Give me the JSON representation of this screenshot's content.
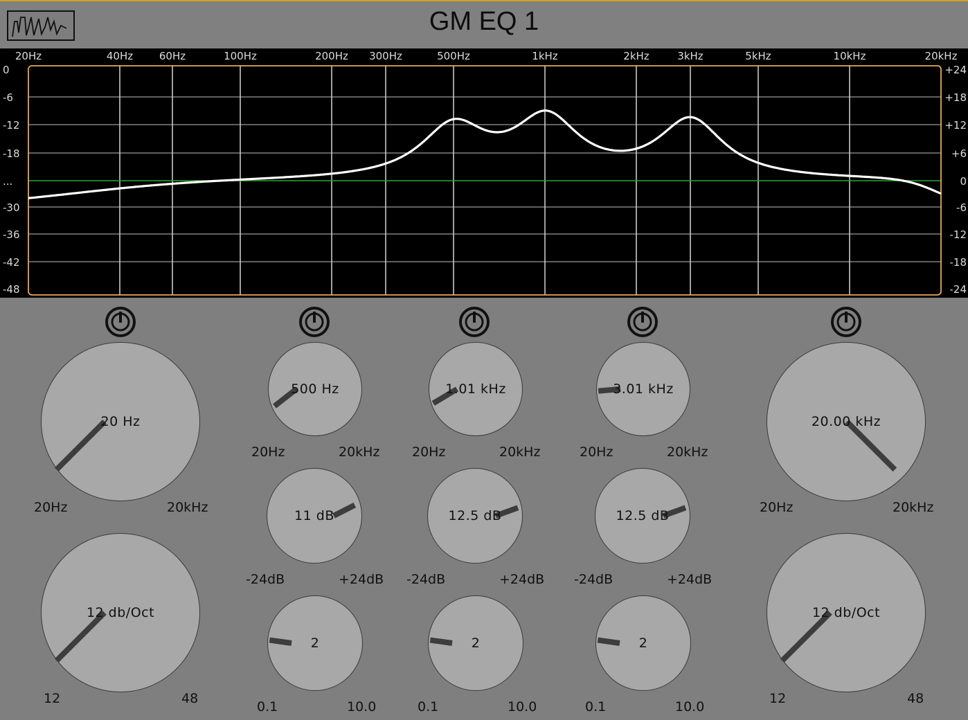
{
  "app": {
    "title": "GM EQ 1",
    "logo_icon": "waveform-logo-icon"
  },
  "graph": {
    "freq_labels": [
      "20Hz",
      "40Hz",
      "60Hz",
      "100Hz",
      "200Hz",
      "300Hz",
      "500Hz",
      "1kHz",
      "2kHz",
      "3kHz",
      "5kHz",
      "10kHz",
      "20kHz"
    ],
    "left_db_labels": [
      "0",
      "-6",
      "-12",
      "-18",
      "...",
      "-30",
      "-36",
      "-42",
      "-48"
    ],
    "right_db_labels": [
      "+24",
      "+18",
      "+12",
      "+6",
      "0",
      "-6",
      "-12",
      "-18",
      "-24"
    ],
    "colors": {
      "curve": "#ffffff",
      "zero_line": "#2fa52f",
      "frame": "#e8a857",
      "grid": "#c8c8c8"
    }
  },
  "bands": {
    "lowcut": {
      "power_icon": "power-icon",
      "freq": {
        "value": "20 Hz",
        "min": "20Hz",
        "max": "20kHz"
      },
      "slope": {
        "value": "12 db/Oct",
        "min": "12",
        "max": "48"
      }
    },
    "peak1": {
      "power_icon": "power-icon",
      "freq": {
        "value": "500 Hz",
        "min": "20Hz",
        "max": "20kHz"
      },
      "gain": {
        "value": "11 dB",
        "min": "-24dB",
        "max": "+24dB"
      },
      "q": {
        "value": "2",
        "min": "0.1",
        "max": "10.0"
      }
    },
    "peak2": {
      "power_icon": "power-icon",
      "freq": {
        "value": "1.01 kHz",
        "min": "20Hz",
        "max": "20kHz"
      },
      "gain": {
        "value": "12.5 dB",
        "min": "-24dB",
        "max": "+24dB"
      },
      "q": {
        "value": "2",
        "min": "0.1",
        "max": "10.0"
      }
    },
    "peak3": {
      "power_icon": "power-icon",
      "freq": {
        "value": "3.01 kHz",
        "min": "20Hz",
        "max": "20kHz"
      },
      "gain": {
        "value": "12.5 dB",
        "min": "-24dB",
        "max": "+24dB"
      },
      "q": {
        "value": "2",
        "min": "0.1",
        "max": "10.0"
      }
    },
    "highcut": {
      "power_icon": "power-icon",
      "freq": {
        "value": "20.00 kHz",
        "min": "20Hz",
        "max": "20kHz"
      },
      "slope": {
        "value": "12 db/Oct",
        "min": "12",
        "max": "48"
      }
    }
  }
}
